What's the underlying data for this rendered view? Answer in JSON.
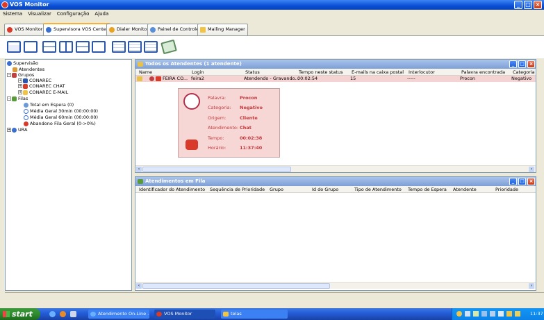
{
  "window": {
    "title": "VOS Monitor"
  },
  "menu": [
    "Sistema",
    "Visualizar",
    "Configuração",
    "Ajuda"
  ],
  "tabs": [
    "VOS Monitor",
    "Supervisora VOS Center",
    "Dialer Monitor",
    "Painel de Controle",
    "Mailing Manager"
  ],
  "active_tab": "Supervisora VOS Center",
  "tree": {
    "root": "Supervisão",
    "atendentes": "Atendentes",
    "grupos": "Grupos",
    "grupo_items": [
      "CONAREC",
      "CONAREC CHAT",
      "CONAREC E-MAIL"
    ],
    "filas": "Filas",
    "fila_items": [
      "Total em Espera (0)",
      "Média Geral 30min (00:00:00)",
      "Média Geral 60min (00:00:00)",
      "Abandono Fila Geral (0->0%)"
    ],
    "ura": "URA"
  },
  "panel1": {
    "title": "Todos os Atendentes (1 atendente)",
    "columns": [
      "Name",
      "Login",
      "Status",
      "Tempo neste status",
      "E-mails na caixa postal",
      "Interlocutor",
      "Palavra encontrada",
      "Categoria"
    ],
    "rows": [
      {
        "name": "FEIRA CO...",
        "login": "feira2",
        "status": "Atendendo - Gravando...",
        "tempo": "00:02:54",
        "emails": "15",
        "interlocutor": "-----",
        "palavra": "Procon",
        "categoria": "Negativo"
      }
    ]
  },
  "tooltip": {
    "labels": [
      "Palavra:",
      "Categoria:",
      "Origem:",
      "Atendimento:",
      "Tempo:",
      "Horário:"
    ],
    "values": [
      "Procon",
      "Negativo",
      "Cliente",
      "Chat",
      "00:02:38",
      "11:37:40"
    ]
  },
  "panel2": {
    "title": "Atendimentos em Fila",
    "columns": [
      "Identificador do Atendimento",
      "Sequência de Prioridade",
      "Grupo",
      "Id do Grupo",
      "Tipo de Atendimento",
      "Tempo de Espera",
      "Atendente",
      "Prioridade"
    ]
  },
  "taskbar": {
    "start": "start",
    "tasks": [
      "Atendimento On-Line ...",
      "VOS Monitor",
      "telas"
    ],
    "clock": "11:37"
  },
  "colors": {
    "title_bar": "#0a4fd6",
    "panel_title": "#7d9fd6",
    "row_highlight": "#f6d3d3",
    "tooltip_bg": "#f7d6d6",
    "tooltip_text": "#c2383a",
    "taskbar": "#245edb",
    "start": "#2f8b2f"
  }
}
